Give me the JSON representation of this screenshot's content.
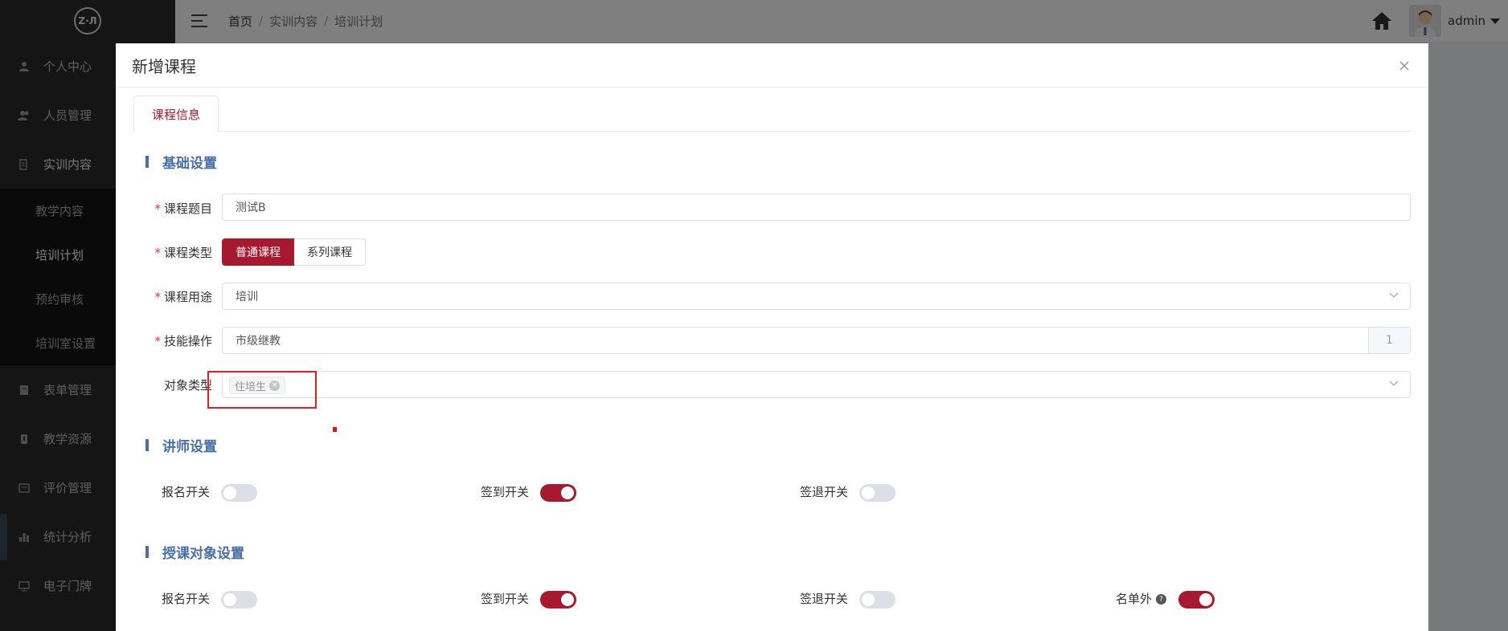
{
  "sidebar": {
    "logo_text": "Z·Л",
    "items": [
      {
        "label": "个人中心",
        "icon": "user-icon"
      },
      {
        "label": "人员管理",
        "icon": "users-icon"
      },
      {
        "label": "实训内容",
        "icon": "content-icon"
      }
    ],
    "submenu": [
      {
        "label": "教学内容"
      },
      {
        "label": "培训计划"
      },
      {
        "label": "预约审核"
      },
      {
        "label": "培训室设置"
      }
    ],
    "items_after": [
      {
        "label": "表单管理",
        "icon": "form-icon"
      },
      {
        "label": "教学资源",
        "icon": "resource-icon"
      },
      {
        "label": "评价管理",
        "icon": "evaluate-icon"
      },
      {
        "label": "统计分析",
        "icon": "chart-icon"
      },
      {
        "label": "电子门牌",
        "icon": "monitor-icon"
      }
    ]
  },
  "header": {
    "breadcrumb": [
      "首页",
      "实训内容",
      "培训计划"
    ],
    "username": "admin"
  },
  "dialog": {
    "title": "新增课程",
    "tab": "课程信息",
    "section_basic": "基础设置",
    "fields": {
      "course_title_label": "课程题目",
      "course_title_value": "测试B",
      "course_type_label": "课程类型",
      "course_type_options": [
        "普通课程",
        "系列课程"
      ],
      "course_use_label": "课程用途",
      "course_use_value": "培训",
      "skill_label": "技能操作",
      "skill_value": "市级继教",
      "skill_count": "1",
      "target_type_label": "对象类型",
      "target_type_tag": "住培生"
    },
    "section_lecturer": "讲师设置",
    "lecturer_switches": [
      {
        "label": "报名开关",
        "on": false
      },
      {
        "label": "签到开关",
        "on": true
      },
      {
        "label": "签退开关",
        "on": false
      }
    ],
    "section_target": "授课对象设置",
    "target_switches": [
      {
        "label": "报名开关",
        "on": false
      },
      {
        "label": "签到开关",
        "on": true
      },
      {
        "label": "签退开关",
        "on": false
      },
      {
        "label": "名单外",
        "on": true
      }
    ]
  },
  "colors": {
    "primary": "#a6192e",
    "section": "#4a6fa5",
    "sidebar_bg": "#2b2b2b"
  }
}
